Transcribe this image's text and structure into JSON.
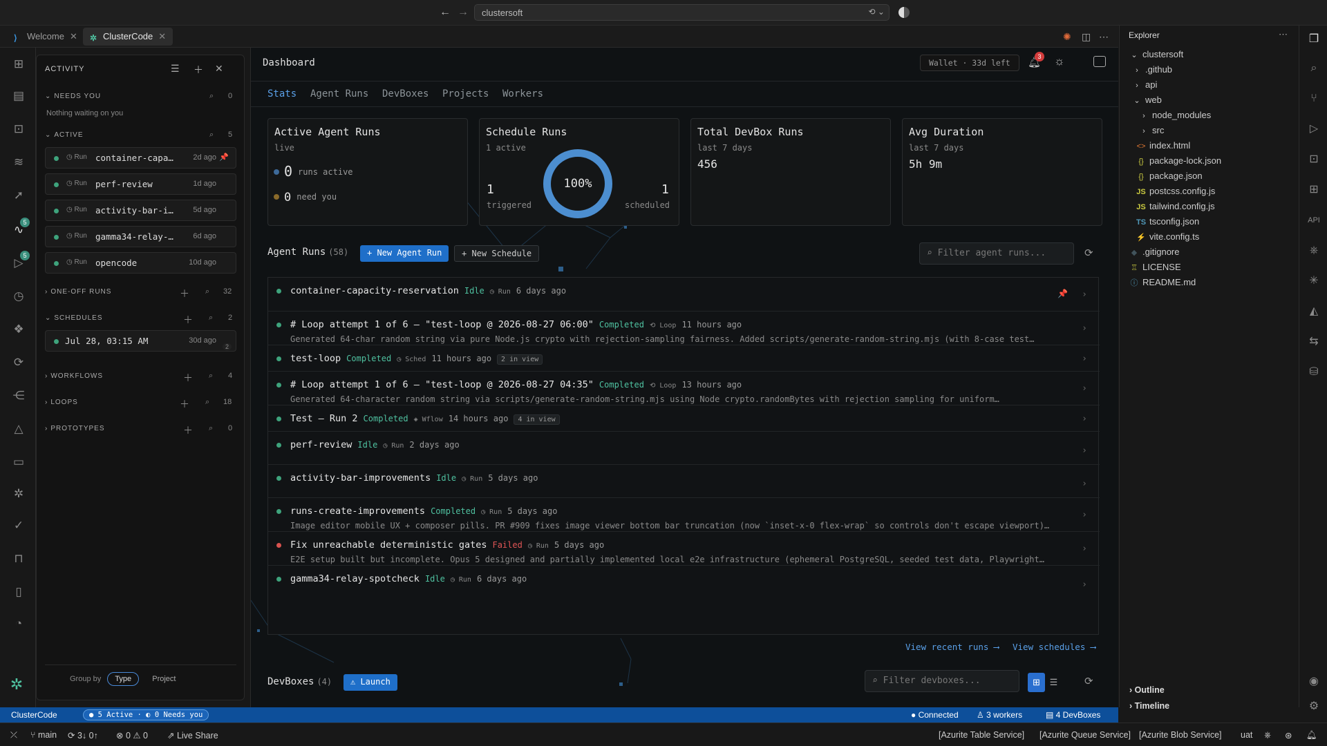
{
  "titlebar": {
    "address": "clustersoft"
  },
  "tabs": [
    {
      "label": "Welcome"
    },
    {
      "label": "ClusterCode"
    }
  ],
  "activity_bar": {
    "badge_activity": "5",
    "badge_runs": "5"
  },
  "activity_panel": {
    "title": "ACTIVITY",
    "needs_you": {
      "label": "NEEDS YOU",
      "count": "0",
      "empty_text": "Nothing waiting on you"
    },
    "active": {
      "label": "ACTIVE",
      "count": "5"
    },
    "active_items": [
      {
        "kind": "Run",
        "name": "container-capa…",
        "age": "2d ago"
      },
      {
        "kind": "Run",
        "name": "perf-review",
        "age": "1d ago"
      },
      {
        "kind": "Run",
        "name": "activity-bar-i…",
        "age": "5d ago"
      },
      {
        "kind": "Run",
        "name": "gamma34-relay-…",
        "age": "6d ago"
      },
      {
        "kind": "Run",
        "name": "opencode",
        "age": "10d ago"
      }
    ],
    "one_off": {
      "label": "ONE-OFF RUNS",
      "count": "32"
    },
    "schedules": {
      "label": "SCHEDULES",
      "count": "2"
    },
    "schedule_items": [
      {
        "name": "Jul 28, 03:15 AM",
        "age": "30d ago",
        "badge": "2"
      }
    ],
    "workflows": {
      "label": "WORKFLOWS",
      "count": "4"
    },
    "loops": {
      "label": "LOOPS",
      "count": "18"
    },
    "prototypes": {
      "label": "PROTOTYPES",
      "count": "0"
    },
    "group_by": {
      "label": "Group by",
      "type": "Type",
      "project": "Project"
    }
  },
  "dashboard": {
    "title": "Dashboard",
    "wallet": "Wallet · 33d left",
    "notification_count": "3",
    "tabs": [
      "Stats",
      "Agent Runs",
      "DevBoxes",
      "Projects",
      "Workers"
    ],
    "cards": {
      "active": {
        "title": "Active Agent Runs",
        "sub": "live",
        "runs_active_num": "0",
        "runs_active_label": "runs active",
        "need_you_num": "0",
        "need_you_label": "need you"
      },
      "schedule": {
        "title": "Schedule Runs",
        "sub": "1 active",
        "percent": "100%",
        "percent_value": 100,
        "triggered_num": "1",
        "triggered_label": "triggered",
        "scheduled_num": "1",
        "scheduled_label": "scheduled"
      },
      "devbox": {
        "title": "Total DevBox Runs",
        "sub": "last 7 days",
        "value": "456"
      },
      "duration": {
        "title": "Avg Duration",
        "sub": "last 7 days",
        "value": "5h 9m"
      }
    },
    "runs": {
      "title": "Agent Runs",
      "count": "(58)",
      "new_run": "+ New Agent Run",
      "new_schedule": "+ New Schedule",
      "filter_placeholder": "Filter agent runs...",
      "items": [
        {
          "title": "container-capacity-reservation",
          "status": "Idle",
          "kind": "Run",
          "age": "6 days ago",
          "desc": "",
          "inview": ""
        },
        {
          "title": "# Loop attempt 1 of 6 — \"test-loop @ 2026-08-27 06:00\"",
          "status": "Completed",
          "kind": "Loop",
          "age": "11 hours ago",
          "desc": "Generated 64-char random string via pure Node.js crypto with rejection-sampling fairness. Added scripts/generate-random-string.mjs (with 8-case test…",
          "inview": ""
        },
        {
          "title": "test-loop",
          "status": "Completed",
          "kind": "Sched",
          "age": "11 hours ago",
          "desc": "",
          "inview": "2 in view"
        },
        {
          "title": "# Loop attempt 1 of 6 — \"test-loop @ 2026-08-27 04:35\"",
          "status": "Completed",
          "kind": "Loop",
          "age": "13 hours ago",
          "desc": "Generated 64-character random string via scripts/generate-random-string.mjs using Node crypto.randomBytes with rejection sampling for uniform…",
          "inview": ""
        },
        {
          "title": "Test — Run 2",
          "status": "Completed",
          "kind": "Wflow",
          "age": "14 hours ago",
          "desc": "",
          "inview": "4 in view"
        },
        {
          "title": "perf-review",
          "status": "Idle",
          "kind": "Run",
          "age": "2 days ago",
          "desc": "",
          "inview": ""
        },
        {
          "title": "activity-bar-improvements",
          "status": "Idle",
          "kind": "Run",
          "age": "5 days ago",
          "desc": "",
          "inview": ""
        },
        {
          "title": "runs-create-improvements",
          "status": "Completed",
          "kind": "Run",
          "age": "5 days ago",
          "desc": "Image editor mobile UX + composer pills. PR #909 fixes image viewer bottom bar truncation (now `inset-x-0 flex-wrap` so controls don't escape viewport)…",
          "inview": ""
        },
        {
          "title": "Fix unreachable deterministic gates",
          "status": "Failed",
          "kind": "Run",
          "age": "5 days ago",
          "desc": "E2E setup built but incomplete. Opus 5 designed and partially implemented local e2e infrastructure (ephemeral PostgreSQL, seeded test data, Playwright…",
          "inview": ""
        },
        {
          "title": "gamma34-relay-spotcheck",
          "status": "Idle",
          "kind": "Run",
          "age": "6 days ago",
          "desc": "",
          "inview": ""
        }
      ],
      "view_recent": "View recent runs ⟶",
      "view_schedules": "View schedules ⟶"
    },
    "devboxes": {
      "title": "DevBoxes",
      "count": "(4)",
      "launch": "⚠ Launch",
      "filter_placeholder": "Filter devboxes..."
    }
  },
  "explorer": {
    "title": "Explorer",
    "root": "clustersoft",
    "items": [
      {
        "label": ".github",
        "type": "folder"
      },
      {
        "label": "api",
        "type": "folder"
      },
      {
        "label": "web",
        "type": "folder-open"
      },
      {
        "label": "node_modules",
        "type": "folder"
      },
      {
        "label": "src",
        "type": "folder"
      },
      {
        "label": "index.html",
        "type": "html"
      },
      {
        "label": "package-lock.json",
        "type": "json"
      },
      {
        "label": "package.json",
        "type": "json"
      },
      {
        "label": "postcss.config.js",
        "type": "js"
      },
      {
        "label": "tailwind.config.js",
        "type": "js"
      },
      {
        "label": "tsconfig.json",
        "type": "ts"
      },
      {
        "label": "vite.config.ts",
        "type": "vite"
      },
      {
        "label": ".gitignore",
        "type": "git"
      },
      {
        "label": "LICENSE",
        "type": "license"
      },
      {
        "label": "README.md",
        "type": "info"
      }
    ],
    "outline": "Outline",
    "timeline": "Timeline"
  },
  "statusbar": {
    "app": "ClusterCode",
    "pill": "● 5 Active · ◐ 0 Needs you",
    "connected": "● Connected",
    "workers": "♙ 3 workers",
    "devboxes": "▤ 4 DevBoxes"
  },
  "vscode_status": {
    "branch": "main",
    "sync": "3↓ 0↑",
    "problems": "⊗ 0 ⚠ 0",
    "liveshare": "Live Share",
    "table": "[Azurite Table Service]",
    "queue": "[Azurite Queue Service]",
    "blob": "[Azurite Blob Service]",
    "env": "uat"
  },
  "colors": {
    "accent": "#5aa0e8",
    "primary_button": "#1f6fc9",
    "success": "#4fc1a0",
    "failed": "#e05555",
    "statusbar": "#0d4f9a"
  }
}
